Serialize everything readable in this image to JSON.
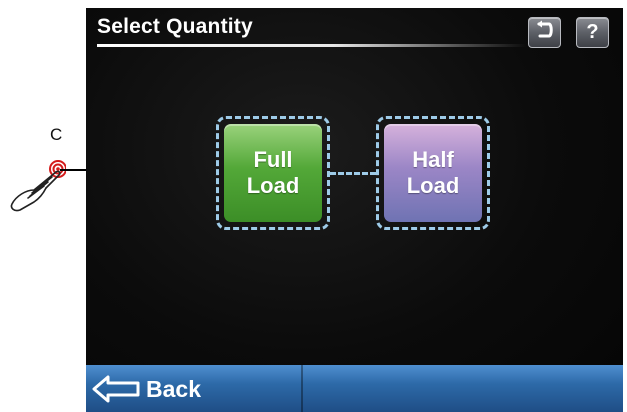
{
  "callout": {
    "letter": "C"
  },
  "header": {
    "title": "Select Quantity",
    "undo_icon": "undo-arrow-icon",
    "help_label": "?"
  },
  "options": {
    "full": {
      "line1": "Full",
      "line2": "Load",
      "color": "#4ea035"
    },
    "half": {
      "line1": "Half",
      "line2": "Load",
      "color": "#8a82c2"
    }
  },
  "bottom_bar": {
    "back_label": "Back",
    "back_icon": "back-arrow-icon",
    "color": "#2d6aa8"
  }
}
